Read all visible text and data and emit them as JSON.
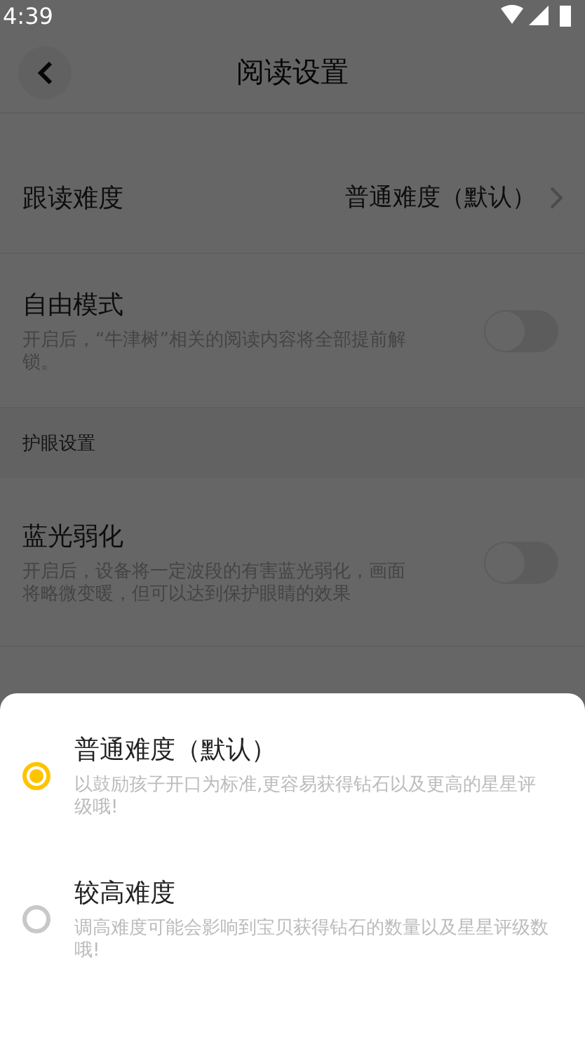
{
  "status_bar": {
    "time": "4:39"
  },
  "header": {
    "title": "阅读设置"
  },
  "settings": [
    {
      "kind": "link",
      "label": "跟读难度",
      "value": "普通难度（默认）"
    },
    {
      "kind": "toggle",
      "label": "自由模式",
      "description": "开启后，“牛津树”相关的阅读内容将全部提前解锁。",
      "on": false
    },
    {
      "kind": "section",
      "label": "护眼设置"
    },
    {
      "kind": "toggle",
      "label": "蓝光弱化",
      "description": "开启后，设备将一定波段的有害蓝光弱化，画面将略微变暖，但可以达到保护眼睛的效果",
      "on": false
    }
  ],
  "sheet": {
    "options": [
      {
        "label": "普通难度（默认）",
        "description": "以鼓励孩子开口为标准,更容易获得钻石以及更高的星星评级哦!",
        "selected": true
      },
      {
        "label": "较高难度",
        "description": "调高难度可能会影响到宝贝获得钻石的数量以及星星评级数哦!",
        "selected": false
      }
    ]
  }
}
